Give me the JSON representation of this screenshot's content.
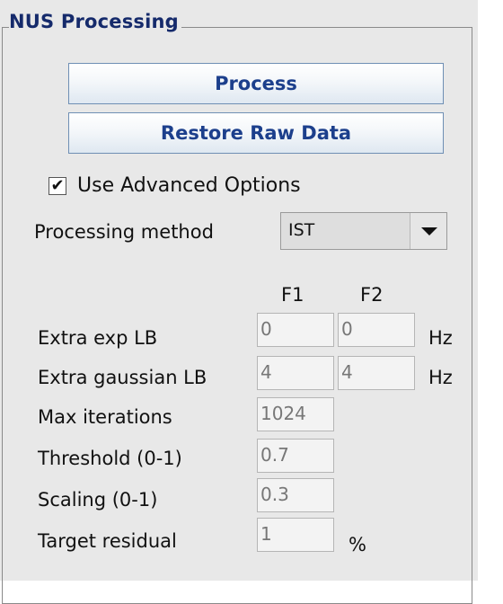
{
  "panel": {
    "title": "NUS Processing"
  },
  "buttons": {
    "process": "Process",
    "restore": "Restore Raw Data"
  },
  "advanced": {
    "label": "Use Advanced Options",
    "checked": true,
    "check_glyph": "✔"
  },
  "method": {
    "label": "Processing method",
    "value": "IST"
  },
  "columns": {
    "f1": "F1",
    "f2": "F2"
  },
  "params": {
    "extra_exp_lb": {
      "label": "Extra exp LB",
      "f1": "0",
      "f2": "0",
      "unit": "Hz"
    },
    "extra_gaussian_lb": {
      "label": "Extra gaussian LB",
      "f1": "4",
      "f2": "4",
      "unit": "Hz"
    },
    "max_iterations": {
      "label": "Max iterations",
      "value": "1024"
    },
    "threshold": {
      "label": "Threshold (0-1)",
      "value": "0.7"
    },
    "scaling": {
      "label": "Scaling (0-1)",
      "value": "0.3"
    },
    "target_residual": {
      "label": "Target residual",
      "value": "1",
      "unit": "%"
    }
  },
  "colors": {
    "panel_bg": "#e8e8e8",
    "title": "#152a6b",
    "button_text": "#1c3f8c",
    "button_border": "#6f8fb4"
  }
}
